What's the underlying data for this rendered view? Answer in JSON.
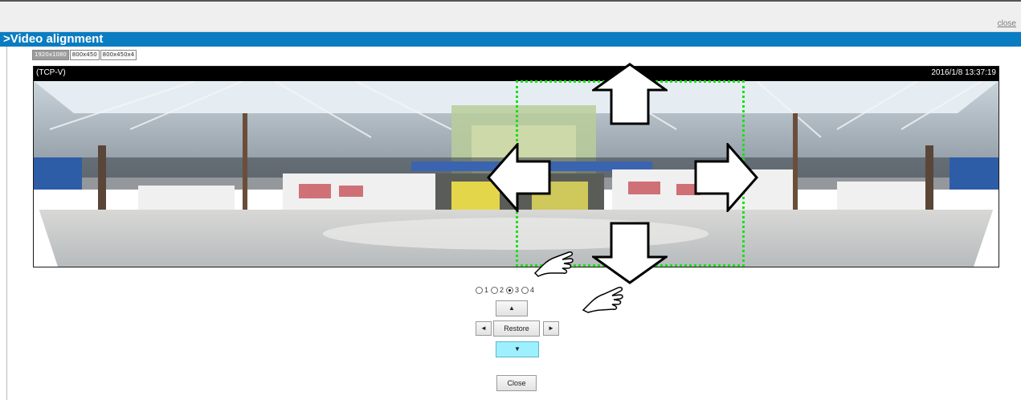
{
  "header": {
    "close_link": "close"
  },
  "section": {
    "title": ">Video alignment"
  },
  "tabs": [
    {
      "label": "1920x1080",
      "active": true
    },
    {
      "label": "800x450",
      "active": false
    },
    {
      "label": "800x450x4",
      "active": false
    }
  ],
  "video": {
    "stream_tag": "(TCP-V)",
    "timestamp": "2016/1/8 13:37:19"
  },
  "radios": [
    {
      "label": "1",
      "checked": false
    },
    {
      "label": "2",
      "checked": false
    },
    {
      "label": "3",
      "checked": true
    },
    {
      "label": "4",
      "checked": false
    }
  ],
  "controls": {
    "up": "▲",
    "left": "◄",
    "restore": "Restore",
    "right": "►",
    "down": "▼",
    "close": "Close"
  },
  "colors": {
    "title_bar": "#0a7cc1",
    "selection_box": "#19e019",
    "selected_button": "#9ef0ff"
  }
}
